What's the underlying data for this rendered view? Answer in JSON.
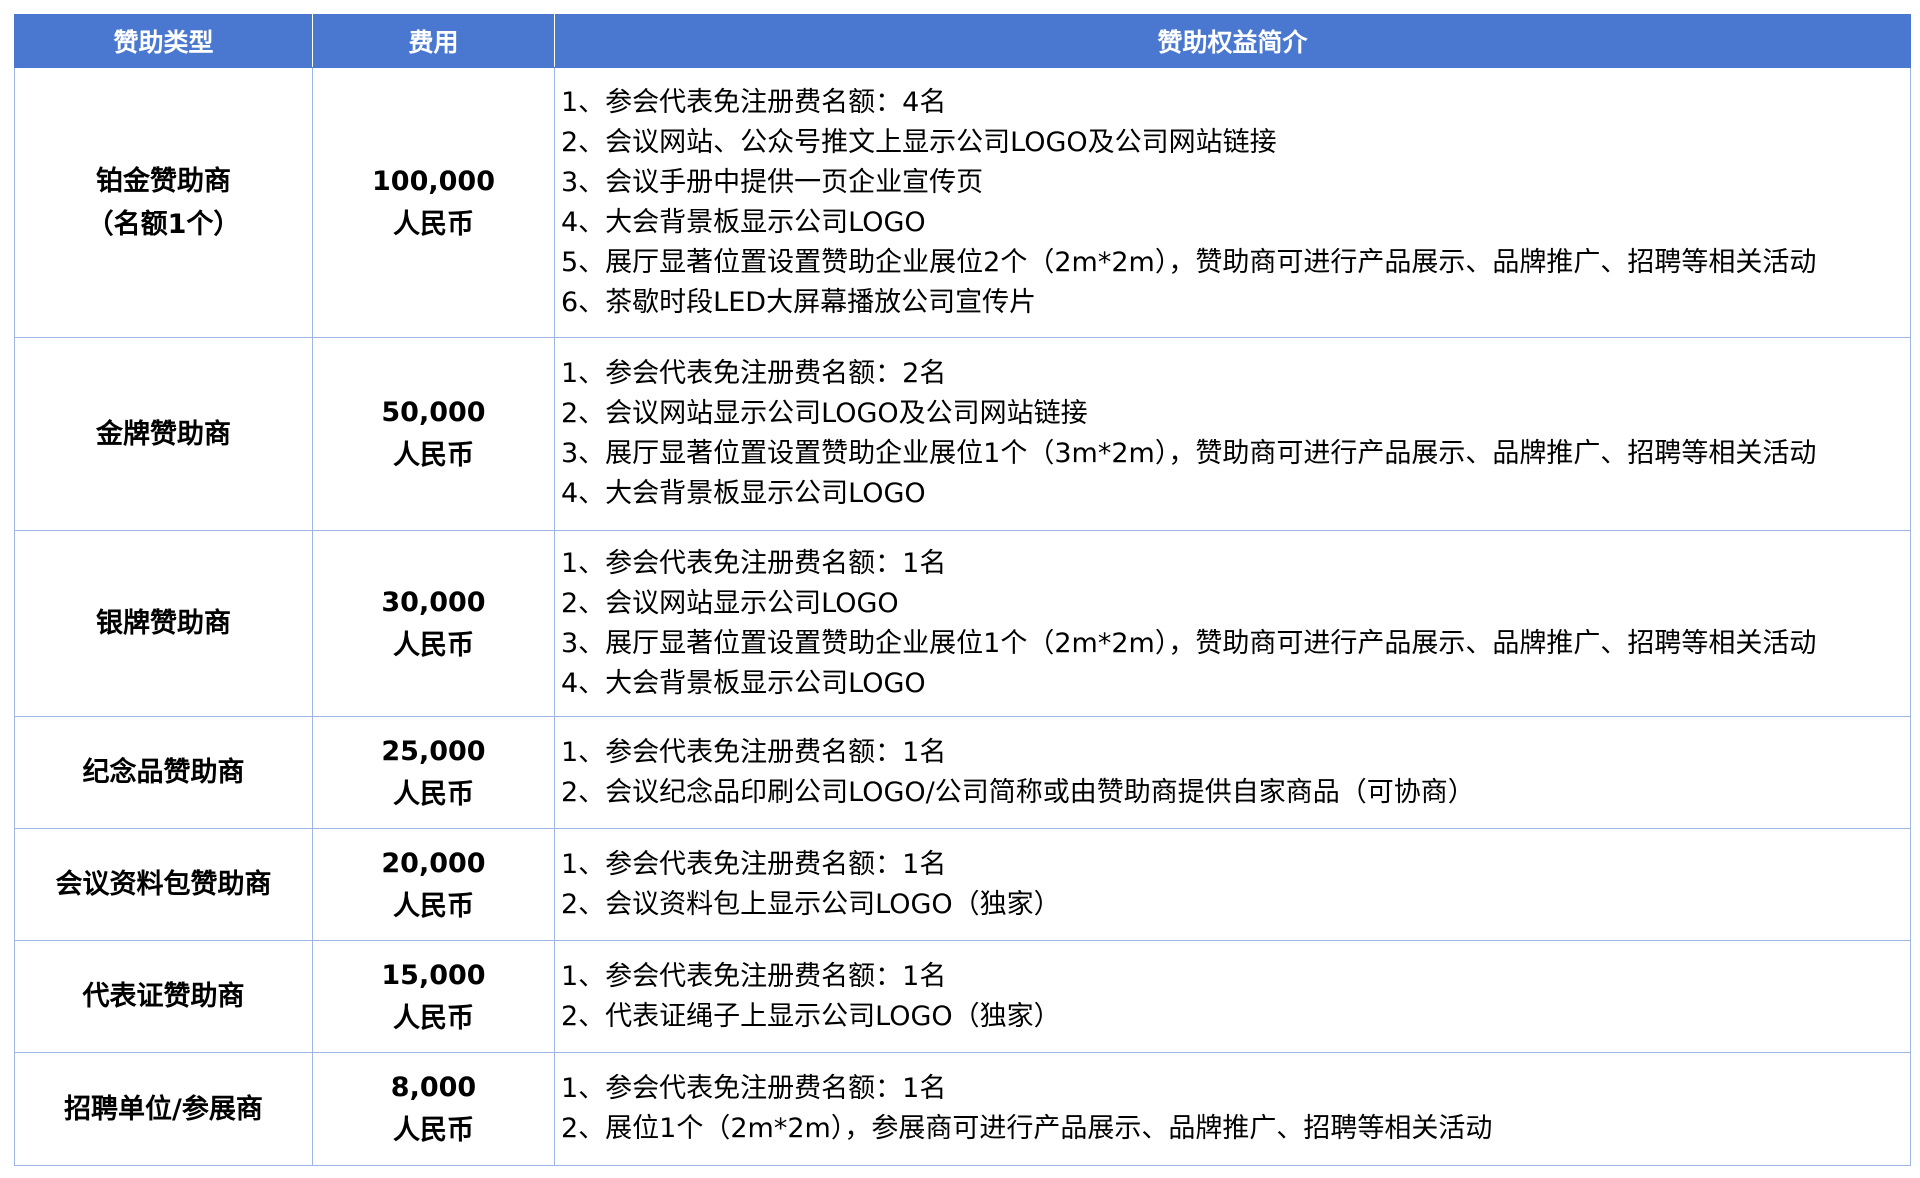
{
  "headers": [
    "赞助类型",
    "费用",
    "赞助权益简介"
  ],
  "rows": [
    {
      "type": [
        "铂金赞助商",
        "（名额1个）"
      ],
      "fee": [
        "100,000",
        "人民币"
      ],
      "benefits": [
        "1、参会代表免注册费名额：4名",
        "2、会议网站、公众号推文上显示公司LOGO及公司网站链接",
        "3、会议手册中提供一页企业宣传页",
        "4、大会背景板显示公司LOGO",
        "5、展厅显著位置设置赞助企业展位2个（2m*2m），赞助商可进行产品展示、品牌推广、招聘等相关活动",
        "6、茶歇时段LED大屏幕播放公司宣传片"
      ]
    },
    {
      "type": [
        "金牌赞助商"
      ],
      "fee": [
        "50,000",
        "人民币"
      ],
      "benefits": [
        "1、参会代表免注册费名额：2名",
        "2、会议网站显示公司LOGO及公司网站链接",
        "3、展厅显著位置设置赞助企业展位1个（3m*2m），赞助商可进行产品展示、品牌推广、招聘等相关活动",
        "4、大会背景板显示公司LOGO"
      ]
    },
    {
      "type": [
        "银牌赞助商"
      ],
      "fee": [
        "30,000",
        "人民币"
      ],
      "benefits": [
        "1、参会代表免注册费名额：1名",
        "2、会议网站显示公司LOGO",
        "3、展厅显著位置设置赞助企业展位1个（2m*2m），赞助商可进行产品展示、品牌推广、招聘等相关活动",
        "4、大会背景板显示公司LOGO"
      ]
    },
    {
      "type": [
        "纪念品赞助商"
      ],
      "fee": [
        "25,000",
        "人民币"
      ],
      "benefits": [
        "1、参会代表免注册费名额：1名",
        "2、会议纪念品印刷公司LOGO/公司简称或由赞助商提供自家商品（可协商）"
      ]
    },
    {
      "type": [
        "会议资料包赞助商"
      ],
      "fee": [
        "20,000",
        "人民币"
      ],
      "benefits": [
        "1、参会代表免注册费名额：1名",
        "2、会议资料包上显示公司LOGO（独家）"
      ]
    },
    {
      "type": [
        "代表证赞助商"
      ],
      "fee": [
        "15,000",
        "人民币"
      ],
      "benefits": [
        "1、参会代表免注册费名额：1名",
        "2、代表证绳子上显示公司LOGO（独家）"
      ]
    },
    {
      "type": [
        "招聘单位/参展商"
      ],
      "fee": [
        "8,000",
        "人民币"
      ],
      "benefits": [
        "1、参会代表免注册费名额：1名",
        "2、展位1个（2m*2m），参展商可进行产品展示、品牌推广、招聘等相关活动"
      ]
    }
  ],
  "colors": {
    "header_bg": "#4a78d0",
    "header_text": "#ffffff",
    "border": "#9db6e6"
  }
}
